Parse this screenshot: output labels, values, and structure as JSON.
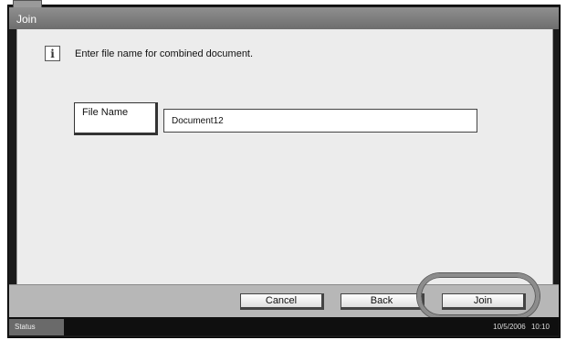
{
  "window": {
    "title": "Join"
  },
  "message": {
    "text": "Enter file name for combined document.",
    "icon": "info-icon"
  },
  "file_name": {
    "button_label": "File Name",
    "value": "Document12"
  },
  "actions": {
    "cancel": "Cancel",
    "back": "Back",
    "join": "Join"
  },
  "status_bar": {
    "status_label": "Status",
    "datetime": "10/5/2006 10:10"
  }
}
